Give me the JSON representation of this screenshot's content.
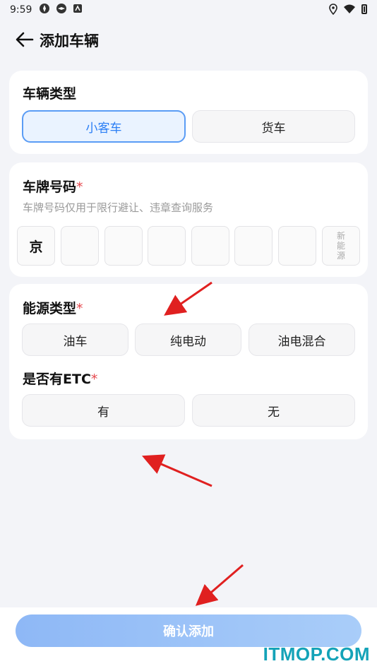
{
  "status_bar": {
    "time": "9:59"
  },
  "header": {
    "title": "添加车辆"
  },
  "vehicle_type": {
    "title": "车辆类型",
    "options": [
      "小客车",
      "货车"
    ],
    "selected": "小客车"
  },
  "plate": {
    "title": "车牌号码",
    "required_mark": "*",
    "hint": "车牌号码仅用于限行避让、违章查询服务",
    "province": "京",
    "new_energy_label": [
      "新",
      "能",
      "源"
    ]
  },
  "energy_type": {
    "title": "能源类型",
    "required_mark": "*",
    "options": [
      "油车",
      "纯电动",
      "油电混合"
    ]
  },
  "etc": {
    "title": "是否有ETC",
    "required_mark": "*",
    "options": [
      "有",
      "无"
    ]
  },
  "confirm": {
    "label": "确认添加"
  },
  "watermark": "ITMOP.COM",
  "colors": {
    "accent": "#2a7ef5",
    "required": "#e5484d",
    "annotation_arrow": "#e02020"
  }
}
